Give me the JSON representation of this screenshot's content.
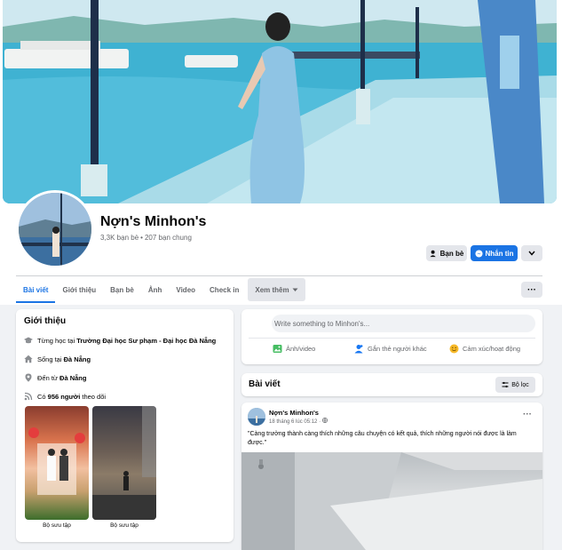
{
  "profile": {
    "name": "Nợn's Minhon's",
    "friends": "3,3K bạn bè",
    "mutual": "207 bạn chung"
  },
  "actions": {
    "friends_label": "Bạn bè",
    "message_label": "Nhắn tin"
  },
  "tabs": [
    {
      "label": "Bài viết",
      "active": true
    },
    {
      "label": "Giới thiệu"
    },
    {
      "label": "Bạn bè"
    },
    {
      "label": "Ảnh"
    },
    {
      "label": "Video"
    },
    {
      "label": "Check in"
    },
    {
      "label": "Xem thêm"
    }
  ],
  "intro": {
    "title": "Giới thiệu",
    "rows": [
      {
        "icon": "graduation-cap-icon",
        "prefix": "Từng học tại ",
        "bold": "Trường Đại học Sư phạm - Đại học Đà Nẵng"
      },
      {
        "icon": "home-icon",
        "prefix": "Sống tại ",
        "bold": "Đà Nẵng"
      },
      {
        "icon": "location-pin-icon",
        "prefix": "Đến từ ",
        "bold": "Đà Nẵng"
      },
      {
        "icon": "rss-icon",
        "prefix": "Có ",
        "bold": "956 người",
        "suffix": " theo dõi"
      }
    ],
    "collections": [
      {
        "label": "Bộ sưu tập"
      },
      {
        "label": "Bộ sưu tập"
      }
    ]
  },
  "composer": {
    "placeholder": "Write something to Minhon's...",
    "photo_label": "Ảnh/video",
    "tag_label": "Gắn thẻ người khác",
    "feeling_label": "Cảm xúc/hoạt động"
  },
  "posts_header": {
    "title": "Bài viết",
    "filter_label": "Bộ lọc"
  },
  "post": {
    "author": "Nợn's Minhon's",
    "date": "18 tháng 6 lúc 05:12",
    "text": "\"Càng trưởng thành càng thích những câu chuyện có kết quả, thích những người nói được là làm được.\""
  },
  "colors": {
    "accent": "#1b74e4",
    "background": "#f0f2f5",
    "secondary_text": "#65676b"
  }
}
